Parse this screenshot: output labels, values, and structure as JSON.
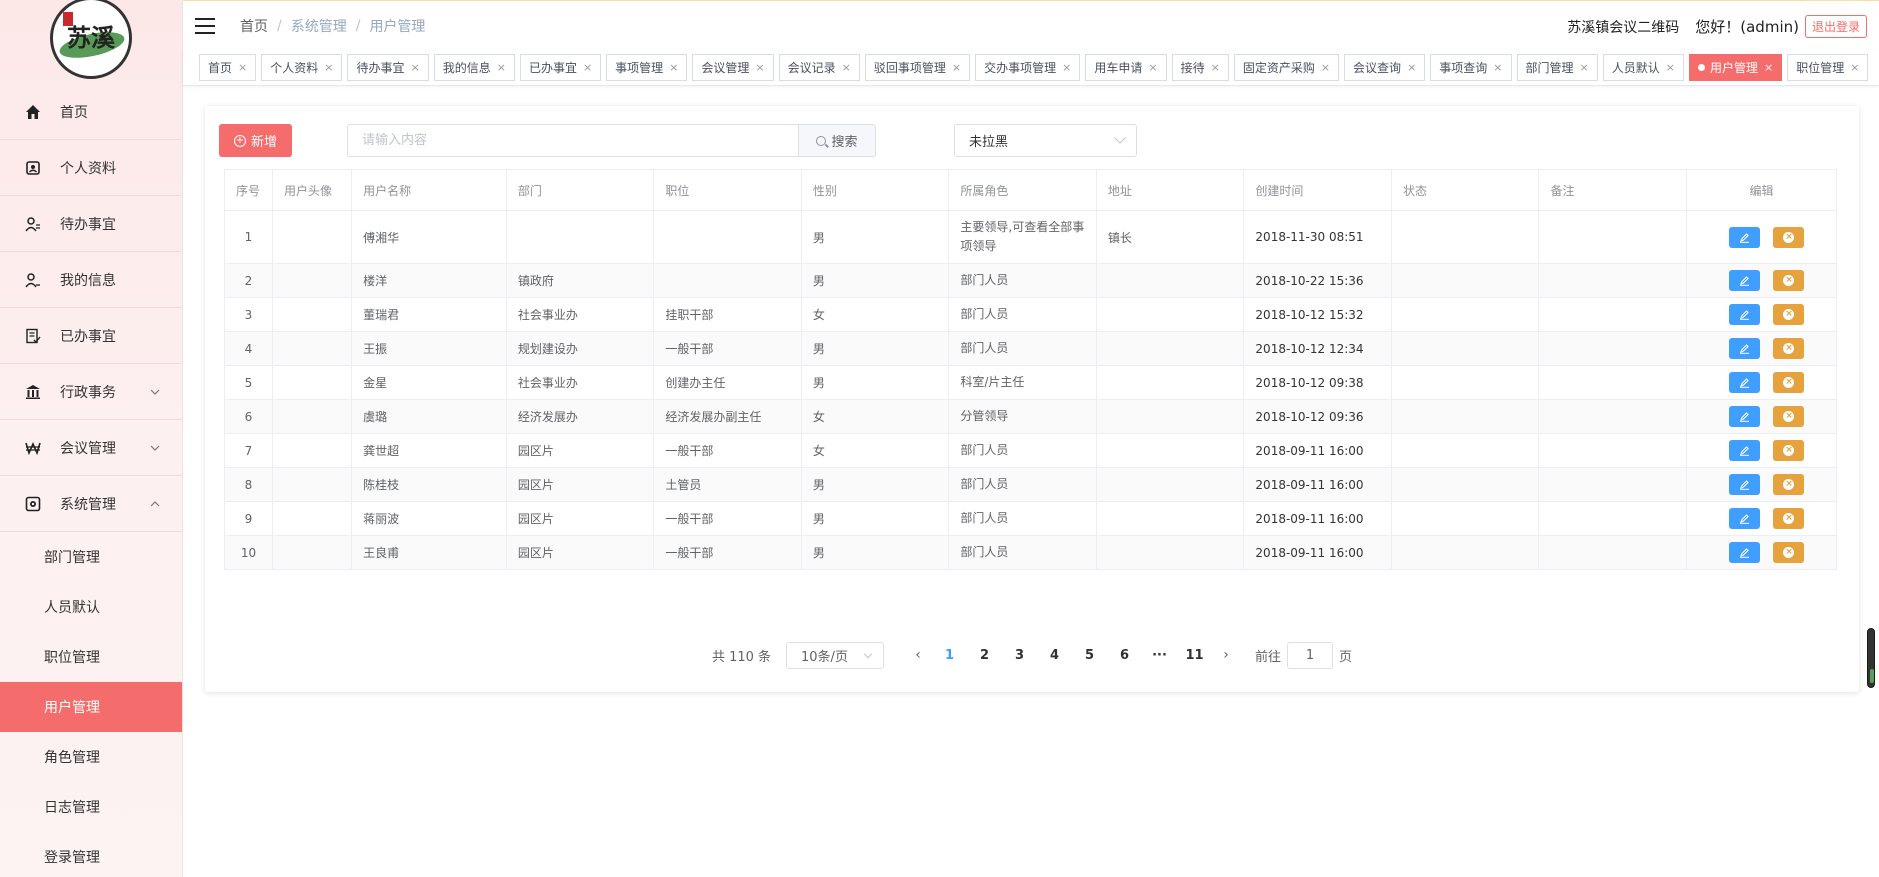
{
  "logo": {
    "text": "苏溪"
  },
  "sidebar": {
    "items": [
      {
        "label": "首页",
        "icon": "home-icon"
      },
      {
        "label": "个人资料",
        "icon": "profile-icon"
      },
      {
        "label": "待办事宜",
        "icon": "user-task-icon"
      },
      {
        "label": "我的信息",
        "icon": "user-info-icon"
      },
      {
        "label": "已办事宜",
        "icon": "done-doc-icon"
      },
      {
        "label": "行政事务",
        "icon": "bank-icon",
        "expanded": false
      },
      {
        "label": "会议管理",
        "icon": "won-icon",
        "expanded": false
      },
      {
        "label": "系统管理",
        "icon": "settings-box-icon",
        "expanded": true
      }
    ],
    "sub_items": [
      {
        "label": "部门管理"
      },
      {
        "label": "人员默认"
      },
      {
        "label": "职位管理"
      },
      {
        "label": "用户管理",
        "active": true
      },
      {
        "label": "角色管理"
      },
      {
        "label": "日志管理"
      },
      {
        "label": "登录管理"
      }
    ]
  },
  "header": {
    "breadcrumb": [
      "首页",
      "系统管理",
      "用户管理"
    ],
    "qr_link": "苏溪镇会议二维码",
    "greeting": "您好！(admin)",
    "logout": "退出登录"
  },
  "tags": [
    {
      "label": "首页"
    },
    {
      "label": "个人资料"
    },
    {
      "label": "待办事宜"
    },
    {
      "label": "我的信息"
    },
    {
      "label": "已办事宜"
    },
    {
      "label": "事项管理"
    },
    {
      "label": "会议管理"
    },
    {
      "label": "会议记录"
    },
    {
      "label": "驳回事项管理"
    },
    {
      "label": "交办事项管理"
    },
    {
      "label": "用车申请"
    },
    {
      "label": "接待"
    },
    {
      "label": "固定资产采购"
    },
    {
      "label": "会议查询"
    },
    {
      "label": "事项查询"
    },
    {
      "label": "部门管理"
    },
    {
      "label": "人员默认"
    },
    {
      "label": "用户管理",
      "active": true
    },
    {
      "label": "职位管理"
    }
  ],
  "toolbar": {
    "add_label": "新增",
    "search_placeholder": "请输入内容",
    "search_label": "搜索",
    "filter_value": "未拉黑"
  },
  "table": {
    "columns": [
      "序号",
      "用户头像",
      "用户名称",
      "部门",
      "职位",
      "性别",
      "所属角色",
      "地址",
      "创建时间",
      "状态",
      "备注",
      "编辑"
    ],
    "rows": [
      {
        "no": "1",
        "name": "傅湘华",
        "dept": "",
        "post": "",
        "gender": "男",
        "role": "主要领导,可查看全部事项领导",
        "addr": "镇长",
        "created": "2018-11-30 08:51"
      },
      {
        "no": "2",
        "name": "楼洋",
        "dept": "镇政府",
        "post": "",
        "gender": "男",
        "role": "部门人员",
        "addr": "",
        "created": "2018-10-22 15:36"
      },
      {
        "no": "3",
        "name": "董瑞君",
        "dept": "社会事业办",
        "post": "挂职干部",
        "gender": "女",
        "role": "部门人员",
        "addr": "",
        "created": "2018-10-12 15:32"
      },
      {
        "no": "4",
        "name": "王振",
        "dept": "规划建设办",
        "post": "一般干部",
        "gender": "男",
        "role": "部门人员",
        "addr": "",
        "created": "2018-10-12 12:34"
      },
      {
        "no": "5",
        "name": "金星",
        "dept": "社会事业办",
        "post": "创建办主任",
        "gender": "男",
        "role": "科室/片主任",
        "addr": "",
        "created": "2018-10-12 09:38"
      },
      {
        "no": "6",
        "name": "虞璐",
        "dept": "经济发展办",
        "post": "经济发展办副主任",
        "gender": "女",
        "role": "分管领导",
        "addr": "",
        "created": "2018-10-12 09:36"
      },
      {
        "no": "7",
        "name": "龚世超",
        "dept": "园区片",
        "post": "一般干部",
        "gender": "女",
        "role": "部门人员",
        "addr": "",
        "created": "2018-09-11 16:00"
      },
      {
        "no": "8",
        "name": "陈桂枝",
        "dept": "园区片",
        "post": "土管员",
        "gender": "男",
        "role": "部门人员",
        "addr": "",
        "created": "2018-09-11 16:00"
      },
      {
        "no": "9",
        "name": "蒋丽波",
        "dept": "园区片",
        "post": "一般干部",
        "gender": "男",
        "role": "部门人员",
        "addr": "",
        "created": "2018-09-11 16:00"
      },
      {
        "no": "10",
        "name": "王良甫",
        "dept": "园区片",
        "post": "一般干部",
        "gender": "男",
        "role": "部门人员",
        "addr": "",
        "created": "2018-09-11 16:00"
      }
    ]
  },
  "pagination": {
    "total": "共 110 条",
    "page_size": "10条/页",
    "pages": [
      "1",
      "2",
      "3",
      "4",
      "5",
      "6",
      "···",
      "11"
    ],
    "current": "1",
    "goto_label": "前往",
    "goto_value": "1",
    "page_unit": "页"
  },
  "colors": {
    "accent": "#f56c6c",
    "primary": "#409eff",
    "warning": "#e6a23c"
  }
}
